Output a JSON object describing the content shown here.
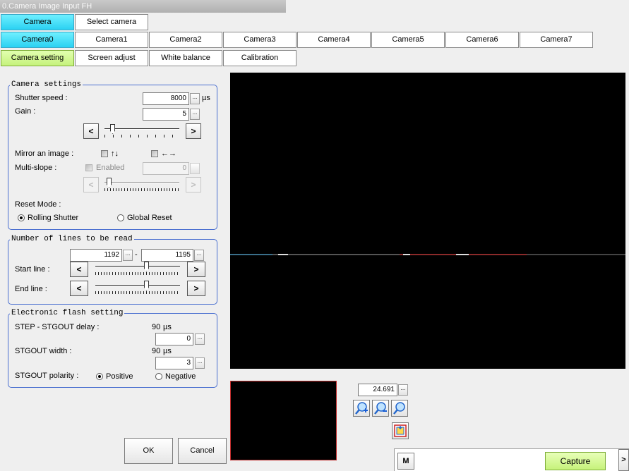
{
  "window": {
    "title": "0.Camera Image Input FH"
  },
  "top_tabs": [
    "Camera",
    "Select camera"
  ],
  "camera_tabs": [
    "Camera0",
    "Camera1",
    "Camera2",
    "Camera3",
    "Camera4",
    "Camera5",
    "Camera6",
    "Camera7"
  ],
  "sub_tabs": [
    "Camera setting",
    "Screen adjust",
    "White balance",
    "Calibration"
  ],
  "camera_settings": {
    "title": "Camera settings",
    "shutter_label": "Shutter speed :",
    "shutter_value": "8000",
    "shutter_unit": "µs",
    "gain_label": "Gain :",
    "gain_value": "5",
    "mirror_label": "Mirror an image :",
    "mirror_vertical_symbol": "↑↓",
    "mirror_horizontal_symbol": "←→",
    "multislope_label": "Multi-slope :",
    "multislope_enabled_label": "Enabled",
    "multislope_value": "0",
    "reset_mode_label": "Reset Mode :",
    "rolling_shutter_label": "Rolling Shutter",
    "global_reset_label": "Global Reset"
  },
  "lines": {
    "title": "Number of lines to be read",
    "from_value": "1192",
    "separator": "-",
    "to_value": "1195",
    "start_label": "Start line :",
    "end_label": "End line :"
  },
  "flash": {
    "title": "Electronic flash setting",
    "delay_label": "STEP - STGOUT delay :",
    "delay_display": "90",
    "delay_unit": "µs",
    "delay_value": "0",
    "width_label": "STGOUT width :",
    "width_display": "90",
    "width_unit": "µs",
    "width_value": "3",
    "polarity_label": "STGOUT polarity :",
    "positive_label": "Positive",
    "negative_label": "Negative"
  },
  "buttons": {
    "ok": "OK",
    "cancel": "Cancel",
    "dots": "...",
    "left": "<",
    "right": ">",
    "m": "M",
    "capture": "Capture",
    "more": ">"
  },
  "zoom": {
    "value": "24.691"
  },
  "icons": [
    "zoom-in-icon",
    "zoom-out-icon",
    "zoom-fit-icon",
    "fit-window-icon"
  ]
}
